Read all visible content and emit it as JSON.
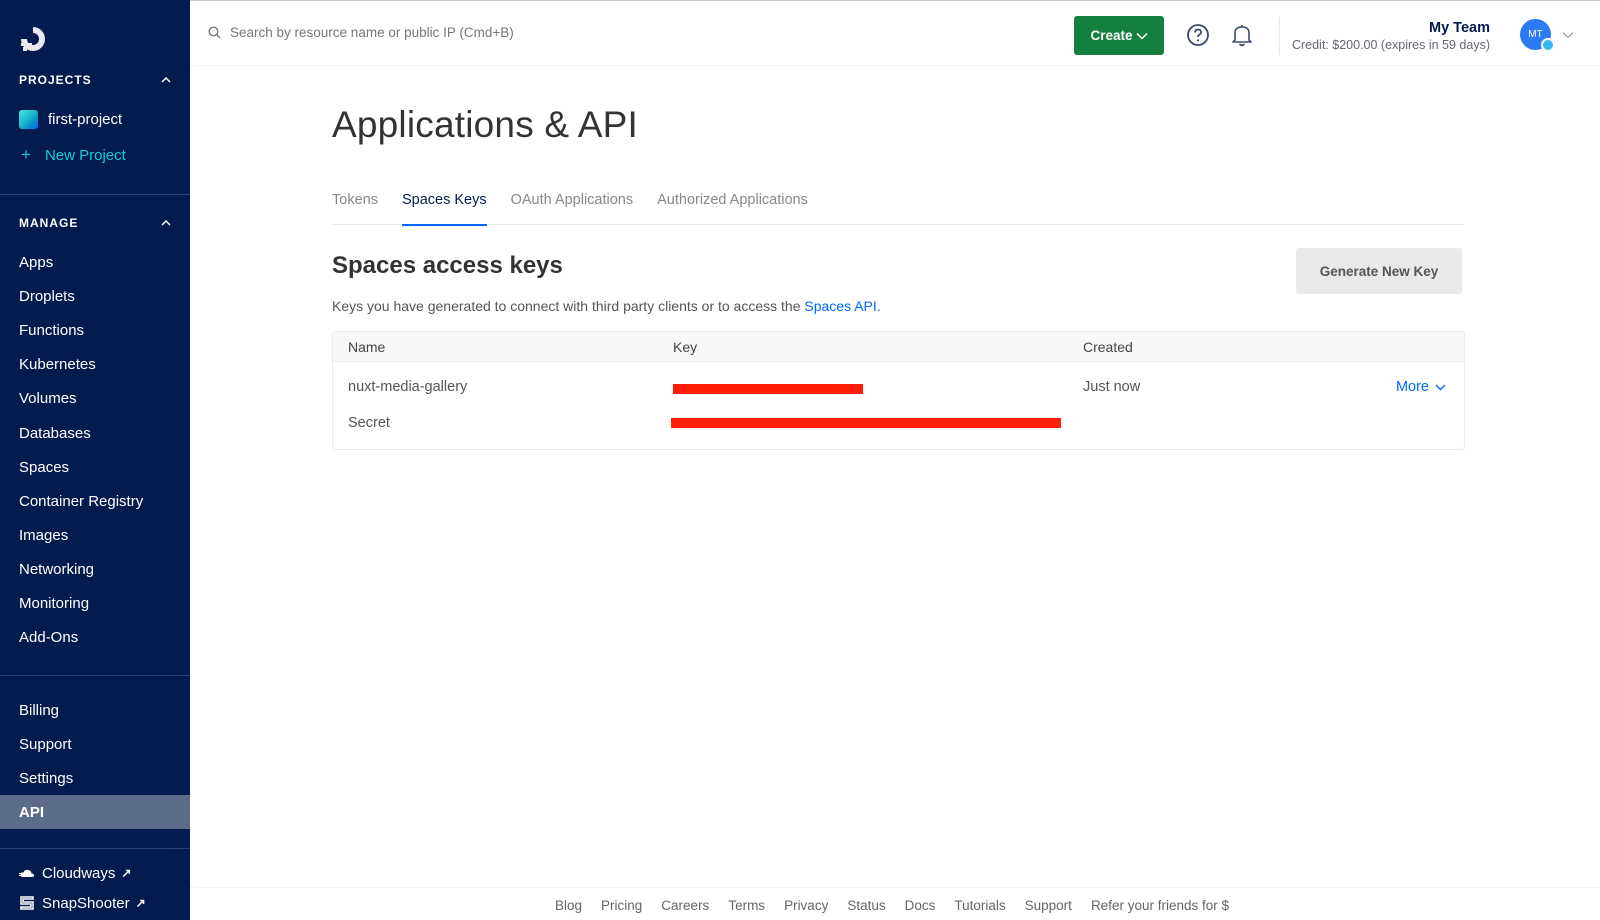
{
  "sidebar": {
    "logo": "digitalocean-logo",
    "projects_heading": "PROJECTS",
    "projects": [
      {
        "label": "first-project"
      }
    ],
    "new_project_label": "New Project",
    "manage_heading": "MANAGE",
    "manage_items": [
      {
        "label": "Apps"
      },
      {
        "label": "Droplets"
      },
      {
        "label": "Functions"
      },
      {
        "label": "Kubernetes"
      },
      {
        "label": "Volumes"
      },
      {
        "label": "Databases"
      },
      {
        "label": "Spaces"
      },
      {
        "label": "Container Registry"
      },
      {
        "label": "Images"
      },
      {
        "label": "Networking"
      },
      {
        "label": "Monitoring"
      },
      {
        "label": "Add-Ons"
      }
    ],
    "account_items": [
      {
        "label": "Billing",
        "active": false
      },
      {
        "label": "Support",
        "active": false
      },
      {
        "label": "Settings",
        "active": false
      },
      {
        "label": "API",
        "active": true
      }
    ],
    "external_links": [
      {
        "label": "Cloudways",
        "icon": "cloud-icon"
      },
      {
        "label": "SnapShooter",
        "icon": "snapshooter-icon"
      }
    ]
  },
  "topbar": {
    "search_placeholder": "Search by resource name or public IP (Cmd+B)",
    "create_label": "Create",
    "team_name": "My Team",
    "credit_text": "Credit: $200.00 (expires in 59 days)",
    "avatar_initials": "MT"
  },
  "main": {
    "title": "Applications & API",
    "tabs": [
      {
        "label": "Tokens",
        "active": false
      },
      {
        "label": "Spaces Keys",
        "active": true
      },
      {
        "label": "OAuth Applications",
        "active": false
      },
      {
        "label": "Authorized Applications",
        "active": false
      }
    ],
    "section_title": "Spaces access keys",
    "section_desc": "Keys you have generated to connect with third party clients or to access the ",
    "section_link": "Spaces API",
    "section_desc_end": ".",
    "generate_label": "Generate New Key",
    "table": {
      "columns": [
        "Name",
        "Key",
        "Created"
      ],
      "rows": [
        {
          "name": "nuxt-media-gallery",
          "key": "[redacted]",
          "secret_label": "Secret",
          "secret": "[redacted]",
          "created": "Just now",
          "action": "More"
        }
      ]
    }
  },
  "footer": {
    "links": [
      "Blog",
      "Pricing",
      "Careers",
      "Terms",
      "Privacy",
      "Status",
      "Docs",
      "Tutorials",
      "Support",
      "Refer your friends for $"
    ]
  },
  "colors": {
    "sidebar_bg": "#031b4e",
    "accent_blue": "#0069ff",
    "create_green": "#15803d",
    "new_project_teal": "#15cdd9",
    "redaction_red": "#ff1e0a"
  }
}
